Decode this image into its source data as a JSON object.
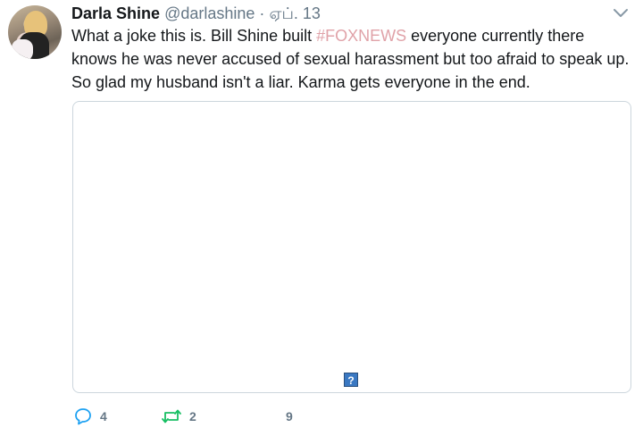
{
  "tweet": {
    "author_name": "Darla Shine",
    "author_handle": "@darlashine",
    "separator": "·",
    "date": "ஏப். 13",
    "text_before": "What a joke this is. Bill Shine built ",
    "hashtag": "#FOXNEWS",
    "text_after": " everyone currently there knows he was never accused of sexual harassment but too afraid to speak up. So glad my husband isn't a liar. Karma gets everyone in the end.",
    "media_icon": "?",
    "actions": {
      "reply_count": "4",
      "retweet_count": "2",
      "like_count": "9"
    }
  },
  "icons": {
    "reply": "reply-icon",
    "retweet": "retweet-icon",
    "like": "heart-icon",
    "menu": "chevron-down-icon"
  },
  "colors": {
    "hashtag": "#e0a2a8",
    "muted": "#657786",
    "border": "#ccd6dd",
    "reply_icon": "#1da1f2",
    "retweet_icon": "#17bf63"
  }
}
